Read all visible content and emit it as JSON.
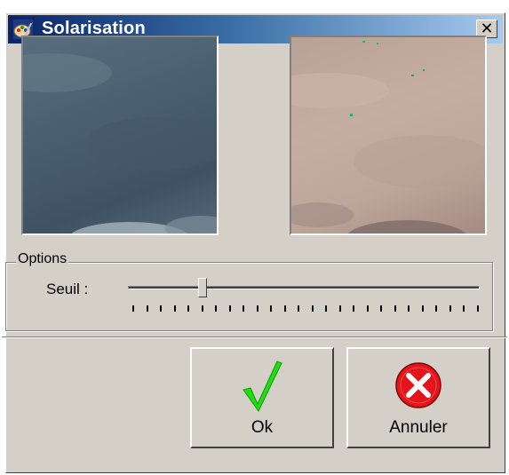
{
  "window": {
    "title": "Solarisation",
    "close_symbol": "✕",
    "title_icon": "palette-icon"
  },
  "previews": {
    "original": "original-image-preview",
    "result": "solarised-image-preview"
  },
  "options": {
    "group_label": "Options",
    "threshold_label": "Seuil :",
    "threshold_fraction": 0.21
  },
  "buttons": {
    "ok_label": "Ok",
    "ok_icon": "checkmark-icon",
    "cancel_label": "Annuler",
    "cancel_icon": "cancel-x-icon"
  },
  "colors": {
    "face": "#d4d0c8",
    "title_start": "#0a246a",
    "title_end": "#a6caf0",
    "ok_green": "#22dd11",
    "cancel_red": "#e3151a"
  }
}
